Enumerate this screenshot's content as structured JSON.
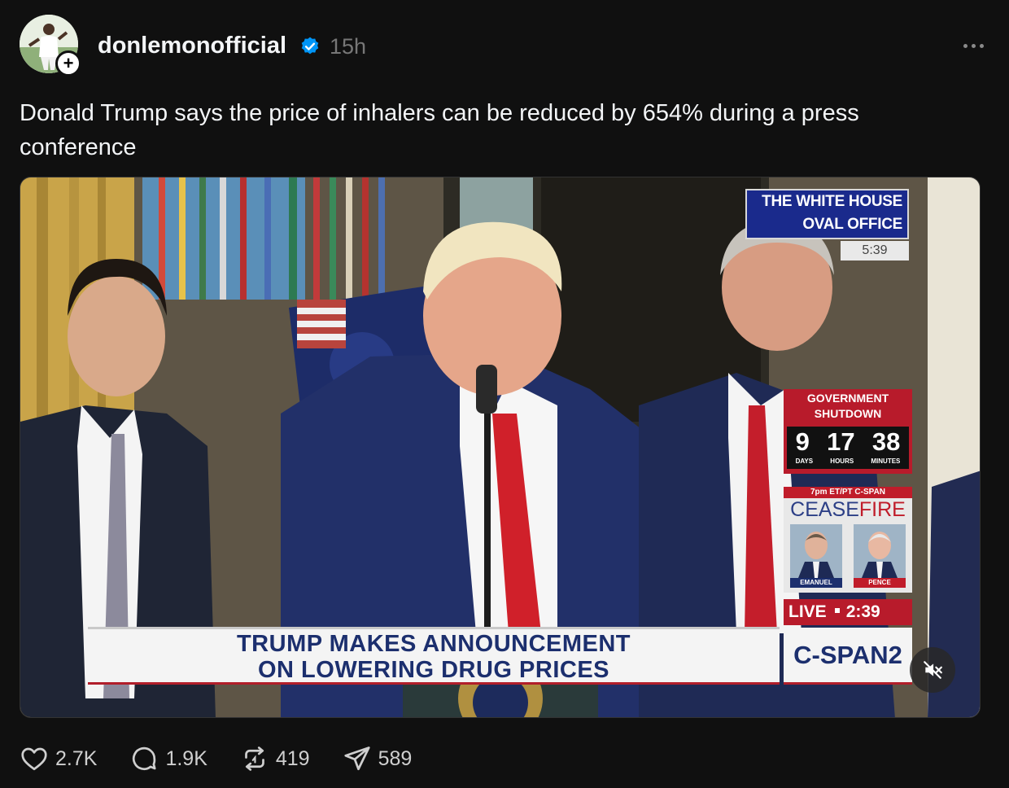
{
  "post": {
    "username": "donlemonofficial",
    "verified": true,
    "time_ago": "15h",
    "follow_symbol": "+",
    "caption": "Donald Trump says the price of inhalers can be reduced by 654% during a press conference"
  },
  "video": {
    "location_line1": "THE WHITE HOUSE",
    "location_line2": "OVAL OFFICE",
    "location_time": "5:39",
    "shutdown_title_line1": "GOVERNMENT",
    "shutdown_title_line2": "SHUTDOWN",
    "shutdown_days": "9",
    "shutdown_hours": "17",
    "shutdown_minutes": "38",
    "shutdown_days_label": "DAYS",
    "shutdown_hours_label": "HOURS",
    "shutdown_minutes_label": "MINUTES",
    "promo_time": "7pm ET/PT C-SPAN",
    "promo_title_part1": "CEASE",
    "promo_title_part2": "FIRE",
    "promo_guest1": "EMANUEL",
    "promo_guest2": "PENCE",
    "live_label": "LIVE",
    "live_time": "2:39",
    "network": "C-SPAN2",
    "chyron_line1": "TRUMP MAKES ANNOUNCEMENT",
    "chyron_line2": "ON LOWERING DRUG PRICES",
    "muted": true
  },
  "actions": {
    "likes": "2.7K",
    "comments": "1.9K",
    "reposts": "419",
    "shares": "589"
  },
  "colors": {
    "background": "#101010",
    "text_primary": "#f3f5f7",
    "text_secondary": "#777777",
    "verified_blue": "#0095f6",
    "cspan_blue": "#1c2f6e",
    "cspan_red": "#b81b2b"
  }
}
